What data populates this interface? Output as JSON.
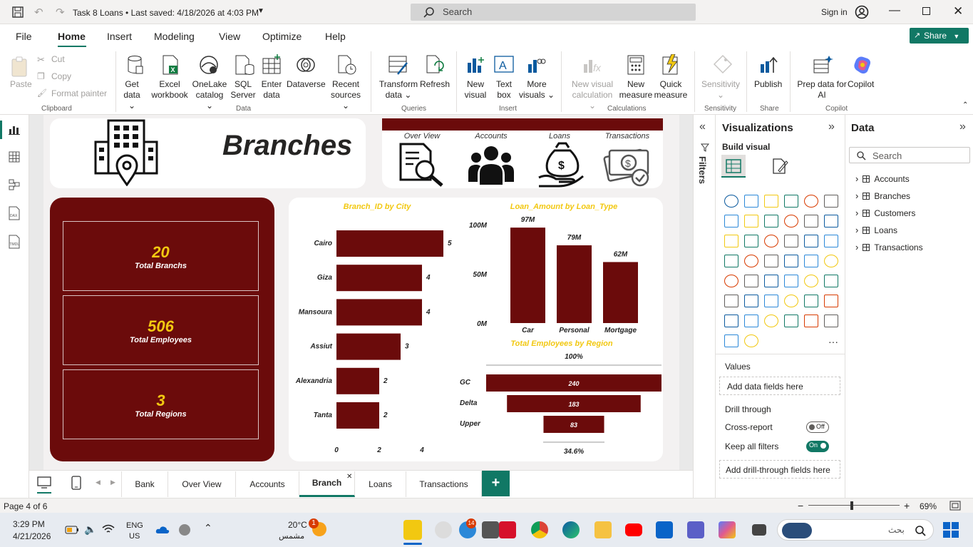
{
  "titlebar": {
    "doc_title": "Task 8 Loans • Last saved: 4/18/2026 at 4:03 PM",
    "search_placeholder": "Search",
    "sign_in": "Sign in"
  },
  "menu": {
    "items": [
      "File",
      "Home",
      "Insert",
      "Modeling",
      "View",
      "Optimize",
      "Help"
    ],
    "active": "Home",
    "share": "Share"
  },
  "ribbon": {
    "clipboard": {
      "paste": "Paste",
      "cut": "Cut",
      "copy": "Copy",
      "format_painter": "Format painter",
      "group": "Clipboard"
    },
    "data": {
      "get_data": [
        "Get",
        "data ⌄"
      ],
      "excel": [
        "Excel",
        "workbook"
      ],
      "onelake": [
        "OneLake",
        "catalog ⌄"
      ],
      "sql": [
        "SQL",
        "Server"
      ],
      "enter": [
        "Enter",
        "data"
      ],
      "dataverse": "Dataverse",
      "recent": [
        "Recent",
        "sources ⌄"
      ],
      "group": "Data"
    },
    "queries": {
      "transform": [
        "Transform",
        "data ⌄"
      ],
      "refresh": "Refresh",
      "group": "Queries"
    },
    "insert": {
      "new_visual": [
        "New",
        "visual"
      ],
      "text_box": [
        "Text",
        "box"
      ],
      "more_visuals": [
        "More",
        "visuals ⌄"
      ],
      "group": "Insert"
    },
    "calculations": {
      "new_visual_calc": [
        "New visual",
        "calculation ⌄"
      ],
      "new_measure": [
        "New",
        "measure"
      ],
      "quick_measure": [
        "Quick",
        "measure"
      ],
      "group": "Calculations"
    },
    "sensitivity": {
      "label": [
        "Sensitivity",
        "⌄"
      ],
      "group": "Sensitivity"
    },
    "share": {
      "publish": "Publish",
      "group": "Share"
    },
    "copilot": {
      "prep": [
        "Prep data for",
        "AI"
      ],
      "copilot": "Copilot",
      "group": "Copilot"
    }
  },
  "report": {
    "header_title": "Branches",
    "nav_buttons": [
      "Over View",
      "Accounts",
      "Loans",
      "Transactions"
    ],
    "kpis": [
      {
        "value": "20",
        "label": "Total Branchs"
      },
      {
        "value": "506",
        "label": "Total Employees"
      },
      {
        "value": "3",
        "label": "Total Regions"
      }
    ],
    "accent_color": "#6b0b0b",
    "kpi_value_color": "#f2c811"
  },
  "chart_data": [
    {
      "type": "bar",
      "orientation": "horizontal",
      "title": "Branch_ID by City",
      "categories": [
        "Cairo",
        "Giza",
        "Mansoura",
        "Assiut",
        "Alexandria",
        "Tanta"
      ],
      "values": [
        5,
        4,
        4,
        3,
        2,
        2
      ],
      "xticks": [
        "0",
        "2",
        "4"
      ],
      "xlim": [
        0,
        5
      ]
    },
    {
      "type": "bar",
      "title": "Loan_Amount by Loan_Type",
      "categories": [
        "Car",
        "Personal",
        "Mortgage"
      ],
      "values": [
        97,
        79,
        62
      ],
      "data_labels": [
        "97M",
        "79M",
        "62M"
      ],
      "yticks": [
        "100M",
        "50M",
        "0M"
      ],
      "ylim": [
        0,
        100
      ]
    },
    {
      "type": "funnel",
      "title": "Total Employees by Region",
      "categories": [
        "GC",
        "Delta",
        "Upper"
      ],
      "values": [
        240,
        183,
        83
      ],
      "top_label": "100%",
      "bottom_label": "34.6%"
    }
  ],
  "tabs": {
    "items": [
      "Bank",
      "Over View",
      "Accounts",
      "Branch",
      "Loans",
      "Transactions"
    ],
    "active": "Branch",
    "add": "+"
  },
  "filters": {
    "label": "Filters"
  },
  "visualizations": {
    "title": "Visualizations",
    "build_visual": "Build visual",
    "values_label": "Values",
    "values_placeholder": "Add data fields here",
    "drill_through": "Drill through",
    "cross_report": "Cross-report",
    "cross_report_state": "Off",
    "keep_all_filters": "Keep all filters",
    "keep_all_filters_state": "On",
    "drill_placeholder": "Add drill-through fields here",
    "more": "···"
  },
  "data_pane": {
    "title": "Data",
    "search_placeholder": "Search",
    "tables": [
      "Accounts",
      "Branches",
      "Customers",
      "Loans",
      "Transactions"
    ]
  },
  "statusbar": {
    "page": "Page 4 of 6",
    "zoom": "69%",
    "minus": "−",
    "plus": "+"
  },
  "taskbar": {
    "time": "3:29 PM",
    "date": "4/21/2026",
    "lang1": "ENG",
    "lang2": "US",
    "temp": "20°C",
    "weather": "مشمس",
    "search_placeholder": "بحث",
    "badge": "1",
    "badge2": "14"
  }
}
